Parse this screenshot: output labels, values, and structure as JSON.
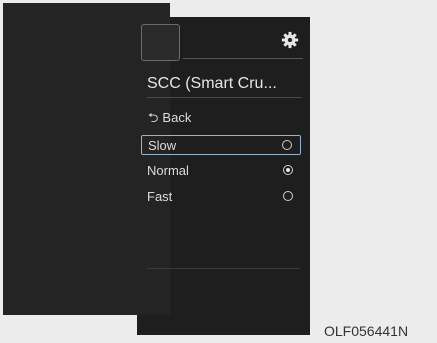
{
  "screen": {
    "settings_icon": "gear-icon",
    "title": "SCC (Smart Cru...",
    "back": {
      "icon": "back-arrow-icon",
      "glyph": "⮌",
      "label": "Back"
    },
    "options": [
      {
        "label": "Slow",
        "selected": false,
        "focused": true
      },
      {
        "label": "Normal",
        "selected": true,
        "focused": false
      },
      {
        "label": "Fast",
        "selected": false,
        "focused": false
      }
    ]
  },
  "figure_code": "OLF056441N"
}
